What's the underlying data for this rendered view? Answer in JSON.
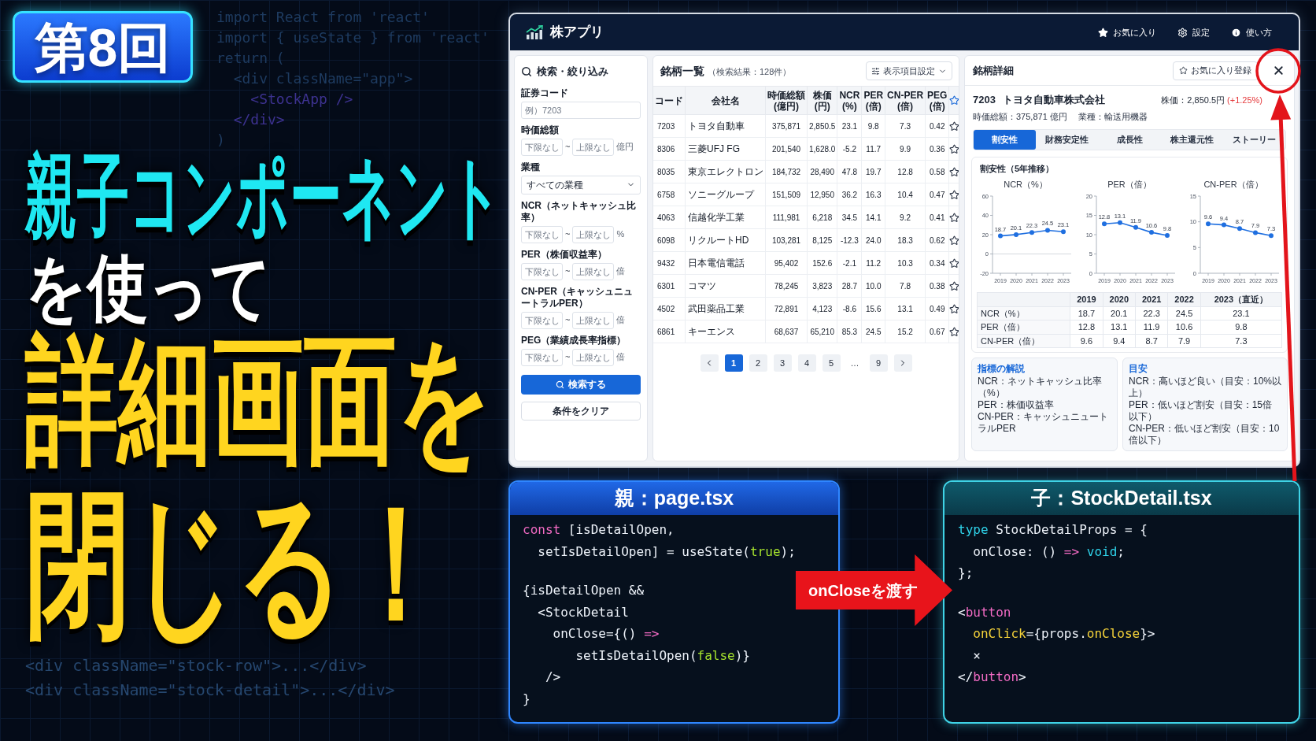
{
  "episode_badge": {
    "text": "第8回"
  },
  "background_code_top": [
    {
      "kind": "plain",
      "text": "import React from 'react'"
    },
    {
      "kind": "plain",
      "text": "import { useState } from 'react'"
    },
    {
      "kind": "plain",
      "text": "return ("
    },
    {
      "kind": "plain",
      "text": "  <div className=\"app\">"
    },
    {
      "kind": "tag",
      "text": "    <StockApp />"
    },
    {
      "kind": "tag",
      "text": "  </div>"
    },
    {
      "kind": "plain",
      "text": ")"
    }
  ],
  "headline": [
    {
      "kind": "accent",
      "text": "親子コンポーネント"
    },
    {
      "kind": "plain",
      "text": "を使って"
    },
    {
      "kind": "highlight",
      "text": "詳細画面を"
    },
    {
      "kind": "highlight",
      "text": "閉じる！"
    }
  ],
  "background_code_bottom": [
    "<div className=\"stock-row\">...</div>",
    "<div className=\"stock-detail\">...</div>"
  ],
  "app": {
    "title": "株アプリ",
    "nav": [
      {
        "kind": "favorites",
        "label": "お気に入り"
      },
      {
        "kind": "settings",
        "label": "設定"
      },
      {
        "kind": "help",
        "label": "使い方"
      }
    ],
    "filters": {
      "title": "検索・絞り込み",
      "fields": [
        {
          "kind": "text",
          "label": "証券コード",
          "placeholder": "例）7203"
        },
        {
          "kind": "range",
          "label": "時価総額",
          "min_placeholder": "下限なし",
          "separator": "~",
          "max_placeholder": "上限なし",
          "unit": "億円"
        },
        {
          "kind": "select",
          "label": "業種",
          "value": "すべての業種"
        },
        {
          "kind": "range",
          "label": "NCR（ネットキャッシュ比率）",
          "min_placeholder": "下限なし",
          "separator": "~",
          "max_placeholder": "上限なし",
          "unit": "%"
        },
        {
          "kind": "range",
          "label": "PER（株価収益率）",
          "min_placeholder": "下限なし",
          "separator": "~",
          "max_placeholder": "上限なし",
          "unit": "倍"
        },
        {
          "kind": "range",
          "label": "CN-PER（キャッシュニュートラルPER）",
          "min_placeholder": "下限なし",
          "separator": "~",
          "max_placeholder": "上限なし",
          "unit": "倍"
        },
        {
          "kind": "range",
          "label": "PEG（業績成長率指標）",
          "min_placeholder": "下限なし",
          "separator": "~",
          "max_placeholder": "上限なし",
          "unit": "倍"
        }
      ],
      "search_button": "検索する",
      "clear_button": "条件をクリア"
    },
    "stock_list": {
      "title": "銘柄一覧",
      "result_count": "（検索結果：128件）",
      "columns_button": "表示項目設定",
      "columns": [
        {
          "label": "コード"
        },
        {
          "label": "会社名"
        },
        {
          "label": "時価総額",
          "unit": "(億円)"
        },
        {
          "label": "株価",
          "unit": "(円)"
        },
        {
          "label": "NCR",
          "unit": "(%)"
        },
        {
          "label": "PER",
          "unit": "(倍)"
        },
        {
          "label": "CN-PER",
          "unit": "(倍)"
        },
        {
          "label": "PEG",
          "unit": "(倍)"
        }
      ],
      "rows": [
        {
          "cells": [
            "7203",
            "トヨタ自動車",
            "375,871",
            "2,850.5",
            "23.1",
            "9.8",
            "7.3",
            "0.42"
          ],
          "favorite": false
        },
        {
          "cells": [
            "8306",
            "三菱UFJ FG",
            "201,540",
            "1,628.0",
            "-5.2",
            "11.7",
            "9.9",
            "0.36"
          ],
          "favorite": false
        },
        {
          "cells": [
            "8035",
            "東京エレクトロン",
            "184,732",
            "28,490",
            "47.8",
            "19.7",
            "12.8",
            "0.58"
          ],
          "favorite": false
        },
        {
          "cells": [
            "6758",
            "ソニーグループ",
            "151,509",
            "12,950",
            "36.2",
            "16.3",
            "10.4",
            "0.47"
          ],
          "favorite": false
        },
        {
          "cells": [
            "4063",
            "信越化学工業",
            "111,981",
            "6,218",
            "34.5",
            "14.1",
            "9.2",
            "0.41"
          ],
          "favorite": false
        },
        {
          "cells": [
            "6098",
            "リクルートHD",
            "103,281",
            "8,125",
            "-12.3",
            "24.0",
            "18.3",
            "0.62"
          ],
          "favorite": false
        },
        {
          "cells": [
            "9432",
            "日本電信電話",
            "95,402",
            "152.6",
            "-2.1",
            "11.2",
            "10.3",
            "0.34"
          ],
          "favorite": false
        },
        {
          "cells": [
            "6301",
            "コマツ",
            "78,245",
            "3,823",
            "28.7",
            "10.0",
            "7.8",
            "0.38"
          ],
          "favorite": false
        },
        {
          "cells": [
            "4502",
            "武田薬品工業",
            "72,891",
            "4,123",
            "-8.6",
            "15.6",
            "13.1",
            "0.49"
          ],
          "favorite": false
        },
        {
          "cells": [
            "6861",
            "キーエンス",
            "68,637",
            "65,210",
            "85.3",
            "24.5",
            "15.2",
            "0.67"
          ],
          "favorite": false
        }
      ],
      "pages": [
        {
          "kind": "page",
          "label": "1",
          "selected": true
        },
        {
          "kind": "page",
          "label": "2",
          "selected": false
        },
        {
          "kind": "page",
          "label": "3",
          "selected": false
        },
        {
          "kind": "page",
          "label": "4",
          "selected": false
        },
        {
          "kind": "page",
          "label": "5",
          "selected": false
        },
        {
          "kind": "gap",
          "label": "…"
        },
        {
          "kind": "page",
          "label": "9",
          "selected": false
        }
      ]
    },
    "detail": {
      "title": "銘柄詳細",
      "favorite_button": "お気に入り登録",
      "code": "7203",
      "company": "トヨタ自動車株式会社",
      "price": "株価：2,850.5円",
      "change": "(+1.25%)",
      "market_cap": "時価総額：375,871 億円",
      "sector": "業種：輸送用機器",
      "tabs": [
        {
          "label": "割安性",
          "selected": true
        },
        {
          "label": "財務安定性",
          "selected": false
        },
        {
          "label": "成長性",
          "selected": false
        },
        {
          "label": "株主還元性",
          "selected": false
        },
        {
          "label": "ストーリー",
          "selected": false
        }
      ],
      "valuation": {
        "title": "割安性（5年推移）",
        "charts": [
          {
            "chart_data": {
              "type": "line",
              "title": "NCR（%）",
              "categories": [
                "2019",
                "2020",
                "2021",
                "2022",
                "2023"
              ],
              "values": [
                18.7,
                20.1,
                22.3,
                24.5,
                23.1
              ],
              "ylim": [
                -20,
                60
              ],
              "yticks": [
                -20,
                0,
                20,
                40,
                60
              ],
              "marker": "circle",
              "data_labels": true
            }
          },
          {
            "chart_data": {
              "type": "line",
              "title": "PER（倍）",
              "categories": [
                "2019",
                "2020",
                "2021",
                "2022",
                "2023"
              ],
              "values": [
                12.8,
                13.1,
                11.9,
                10.6,
                9.8
              ],
              "ylim": [
                0,
                20
              ],
              "yticks": [
                0,
                5,
                10,
                15,
                20
              ],
              "marker": "circle",
              "data_labels": true
            }
          },
          {
            "chart_data": {
              "type": "line",
              "title": "CN-PER（倍）",
              "categories": [
                "2019",
                "2020",
                "2021",
                "2022",
                "2023"
              ],
              "values": [
                9.6,
                9.4,
                8.7,
                7.9,
                7.3
              ],
              "ylim": [
                0,
                15
              ],
              "yticks": [
                0,
                5,
                10,
                15
              ],
              "marker": "circle",
              "data_labels": true
            }
          }
        ],
        "table": {
          "columns": [
            "2019",
            "2020",
            "2021",
            "2022",
            "2023（直近）"
          ],
          "rows": [
            {
              "label": "NCR（%）",
              "values": [
                "18.7",
                "20.1",
                "22.3",
                "24.5",
                "23.1"
              ]
            },
            {
              "label": "PER（倍）",
              "values": [
                "12.8",
                "13.1",
                "11.9",
                "10.6",
                "9.8"
              ]
            },
            {
              "label": "CN-PER（倍）",
              "values": [
                "9.6",
                "9.4",
                "8.7",
                "7.9",
                "7.3"
              ]
            }
          ]
        }
      },
      "glossary": {
        "title": "指標の解説",
        "lines": [
          "NCR：ネットキャッシュ比率（%）",
          "PER：株価収益率",
          "CN-PER：キャッシュニュートラルPER"
        ]
      },
      "guidelines": {
        "title": "目安",
        "lines": [
          "NCR：高いほど良い（目安：10%以上）",
          "PER：低いほど割安（目安：15倍以下）",
          "CN-PER：低いほど割安（目安：10倍以下）"
        ]
      }
    }
  },
  "parent_code": {
    "title": "親：page.tsx",
    "blocks": [
      {
        "lines": [
          [
            {
              "kind": "keyword",
              "text": "const"
            },
            {
              "kind": "plain",
              "text": " [isDetailOpen,"
            }
          ],
          [
            {
              "kind": "plain",
              "text": "  setIsDetailOpen] = useState("
            },
            {
              "kind": "literal",
              "text": "true"
            },
            {
              "kind": "plain",
              "text": ");"
            }
          ]
        ]
      },
      {
        "lines": [
          [
            {
              "kind": "plain",
              "text": "{isDetailOpen &&"
            }
          ],
          [
            {
              "kind": "plain",
              "text": "  <StockDetail"
            }
          ],
          [
            {
              "kind": "plain",
              "text": "    onClose={() "
            },
            {
              "kind": "keyword",
              "text": "=>"
            }
          ],
          [
            {
              "kind": "plain",
              "text": "       setIsDetailOpen("
            },
            {
              "kind": "literal",
              "text": "false"
            },
            {
              "kind": "plain",
              "text": ")}"
            }
          ],
          [
            {
              "kind": "plain",
              "text": "   />"
            }
          ],
          [
            {
              "kind": "plain",
              "text": "}"
            }
          ]
        ]
      }
    ]
  },
  "handoff_label": {
    "text": "onCloseを渡す"
  },
  "child_code": {
    "title": "子：StockDetail.tsx",
    "blocks": [
      {
        "lines": [
          [
            {
              "kind": "storage",
              "text": "type"
            },
            {
              "kind": "plain",
              "text": " StockDetailProps = {"
            }
          ],
          [
            {
              "kind": "plain",
              "text": "  onClose: () "
            },
            {
              "kind": "keyword",
              "text": "=>"
            },
            {
              "kind": "storage",
              "text": " void"
            },
            {
              "kind": "plain",
              "text": ";"
            }
          ],
          [
            {
              "kind": "plain",
              "text": "};"
            }
          ]
        ]
      },
      {
        "lines": [
          [
            {
              "kind": "plain",
              "text": "<"
            },
            {
              "kind": "keyword",
              "text": "button"
            }
          ],
          [
            {
              "kind": "attr",
              "text": "  onClick"
            },
            {
              "kind": "plain",
              "text": "={props."
            },
            {
              "kind": "attr",
              "text": "onClose"
            },
            {
              "kind": "plain",
              "text": "}>"
            }
          ],
          [
            {
              "kind": "plain",
              "text": "  ×"
            }
          ],
          [
            {
              "kind": "plain",
              "text": "</"
            },
            {
              "kind": "keyword",
              "text": "button"
            },
            {
              "kind": "plain",
              "text": ">"
            }
          ]
        ]
      }
    ]
  }
}
